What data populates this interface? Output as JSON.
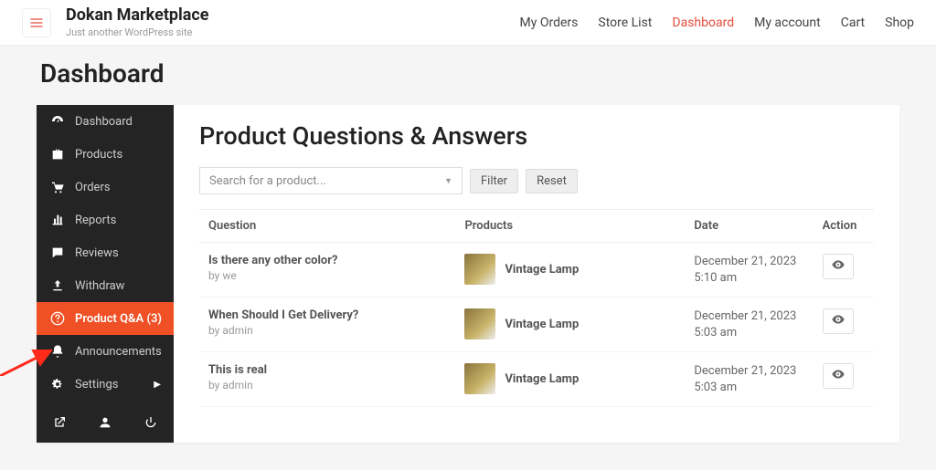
{
  "brand": {
    "title": "Dokan Marketplace",
    "tagline": "Just another WordPress site"
  },
  "topnav": {
    "items": [
      {
        "label": "My Orders"
      },
      {
        "label": "Store List"
      },
      {
        "label": "Dashboard",
        "active": true
      },
      {
        "label": "My account"
      },
      {
        "label": "Cart"
      },
      {
        "label": "Shop"
      }
    ]
  },
  "page": {
    "title": "Dashboard"
  },
  "sidebar": {
    "items": [
      {
        "label": "Dashboard"
      },
      {
        "label": "Products"
      },
      {
        "label": "Orders"
      },
      {
        "label": "Reports"
      },
      {
        "label": "Reviews"
      },
      {
        "label": "Withdraw"
      },
      {
        "label": "Product Q&A (3)",
        "active": true
      },
      {
        "label": "Announcements"
      },
      {
        "label": "Settings",
        "hasCaret": true
      }
    ]
  },
  "content": {
    "title": "Product Questions & Answers",
    "search_placeholder": "Search for a product...",
    "btn_filter": "Filter",
    "btn_reset": "Reset",
    "columns": {
      "question": "Question",
      "products": "Products",
      "date": "Date",
      "action": "Action"
    },
    "rows": [
      {
        "question": "Is there any other color?",
        "by": "by we",
        "product": "Vintage Lamp",
        "date": "December 21, 2023 5:10 am"
      },
      {
        "question": "When Should I Get Delivery?",
        "by": "by admin",
        "product": "Vintage Lamp",
        "date": "December 21, 2023 5:03 am"
      },
      {
        "question": "This is real",
        "by": "by admin",
        "product": "Vintage Lamp",
        "date": "December 21, 2023 5:03 am"
      }
    ]
  }
}
